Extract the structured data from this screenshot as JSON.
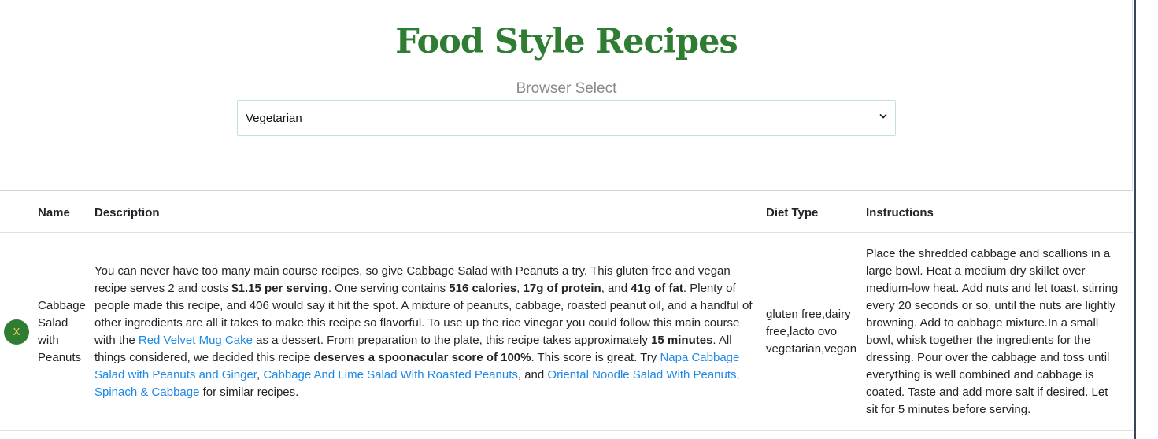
{
  "header": {
    "title": "Food Style Recipes",
    "select_label": "Browser Select",
    "select_value": "Vegetarian"
  },
  "table": {
    "columns": [
      "Name",
      "Description",
      "Diet Type",
      "Instructions"
    ],
    "rows": [
      {
        "remove_label": "X",
        "name_lines": [
          "Cabbage",
          "Salad",
          "with",
          "Peanuts"
        ],
        "description": {
          "t1": "You can never have too many main course recipes, so give Cabbage Salad with Peanuts a try. This gluten free and vegan recipe serves 2 and costs ",
          "b1": "$1.15 per serving",
          "t2": ". One serving contains ",
          "b2": "516 calories",
          "t3": ", ",
          "b3": "17g of protein",
          "t4": ", and ",
          "b4": "41g of fat",
          "t5": ". Plenty of people made this recipe, and 406 would say it hit the spot. A mixture of peanuts, cabbage, roasted peanut oil, and a handful of other ingredients are all it takes to make this recipe so flavorful. To use up the rice vinegar you could follow this main course with the ",
          "l1": "Red Velvet Mug Cake",
          "t6": " as a dessert. From preparation to the plate, this recipe takes approximately ",
          "b5": "15 minutes",
          "t7": ". All things considered, we decided this recipe ",
          "b6": "deserves a spoonacular score of 100%",
          "t8": ". This score is great. Try ",
          "l2": "Napa Cabbage Salad with Peanuts and Ginger",
          "t9": ", ",
          "l3": "Cabbage And Lime Salad With Roasted Peanuts",
          "t10": ", and ",
          "l4": "Oriental Noodle Salad With Peanuts, Spinach & Cabbage",
          "t11": " for similar recipes."
        },
        "diet_lines": [
          "gluten free,dairy",
          "free,lacto ovo",
          "vegetarian,vegan"
        ],
        "instructions_lines": [
          "Place the shredded cabbage and scallions in a",
          "large bowl. Heat a medium dry skillet over",
          "medium-low heat. Add nuts and let toast, stirring",
          "every 20 seconds or so, until the nuts are lightly",
          "browning. Add to cabbage mixture.In a small",
          "bowl, whisk together the ingredients for the",
          "dressing. Pour over the cabbage and toss until",
          "everything is well combined and cabbage is",
          "coated. Taste and add more salt if desired. Let",
          "sit for 5 minutes before serving."
        ]
      }
    ]
  },
  "icons": {
    "chevron": "chevron-down-icon"
  },
  "colors": {
    "title_green": "#2e7d32",
    "link_blue": "#1e88e5",
    "remove_button": "#2e7d32",
    "remove_text": "#ffd54f"
  }
}
